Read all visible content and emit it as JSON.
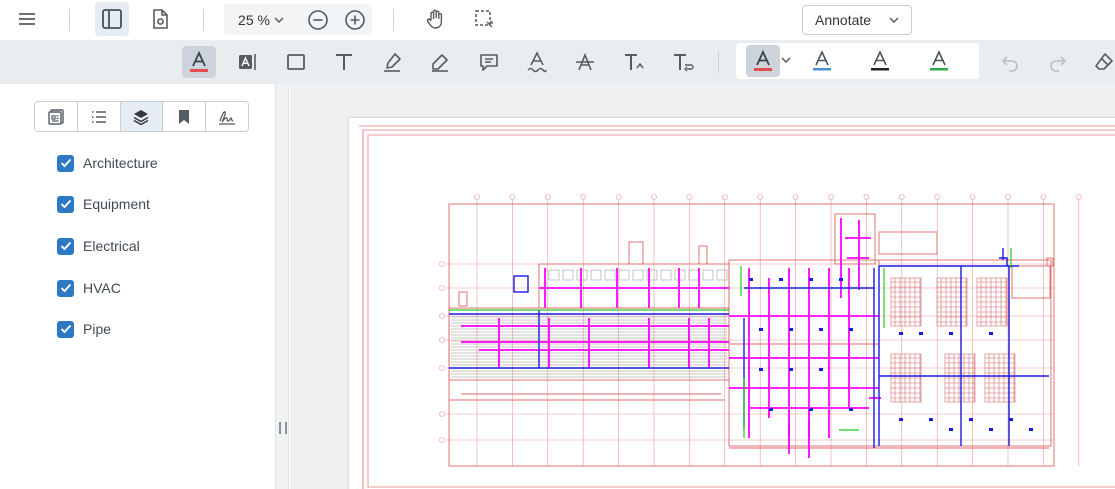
{
  "header": {
    "zoom_value": "25 %",
    "mode_select_value": "Annotate"
  },
  "layers_panel": {
    "layers": [
      {
        "label": "Architecture",
        "checked": true
      },
      {
        "label": "Equipment",
        "checked": true
      },
      {
        "label": "Electrical",
        "checked": true
      },
      {
        "label": "HVAC",
        "checked": true
      },
      {
        "label": "Pipe",
        "checked": true
      }
    ]
  },
  "annotation_colors": {
    "text_color_active": "#e44d4d",
    "underline_blue": "#4a8fd8",
    "underline_black": "#222222",
    "underline_green": "#2ea84a"
  },
  "drawing_colors": {
    "architecture": "#e57a7a",
    "electrical": "#1414d8",
    "hvac": "#ff00ff",
    "pipe": "#22cc22",
    "equipment": "#888888"
  }
}
